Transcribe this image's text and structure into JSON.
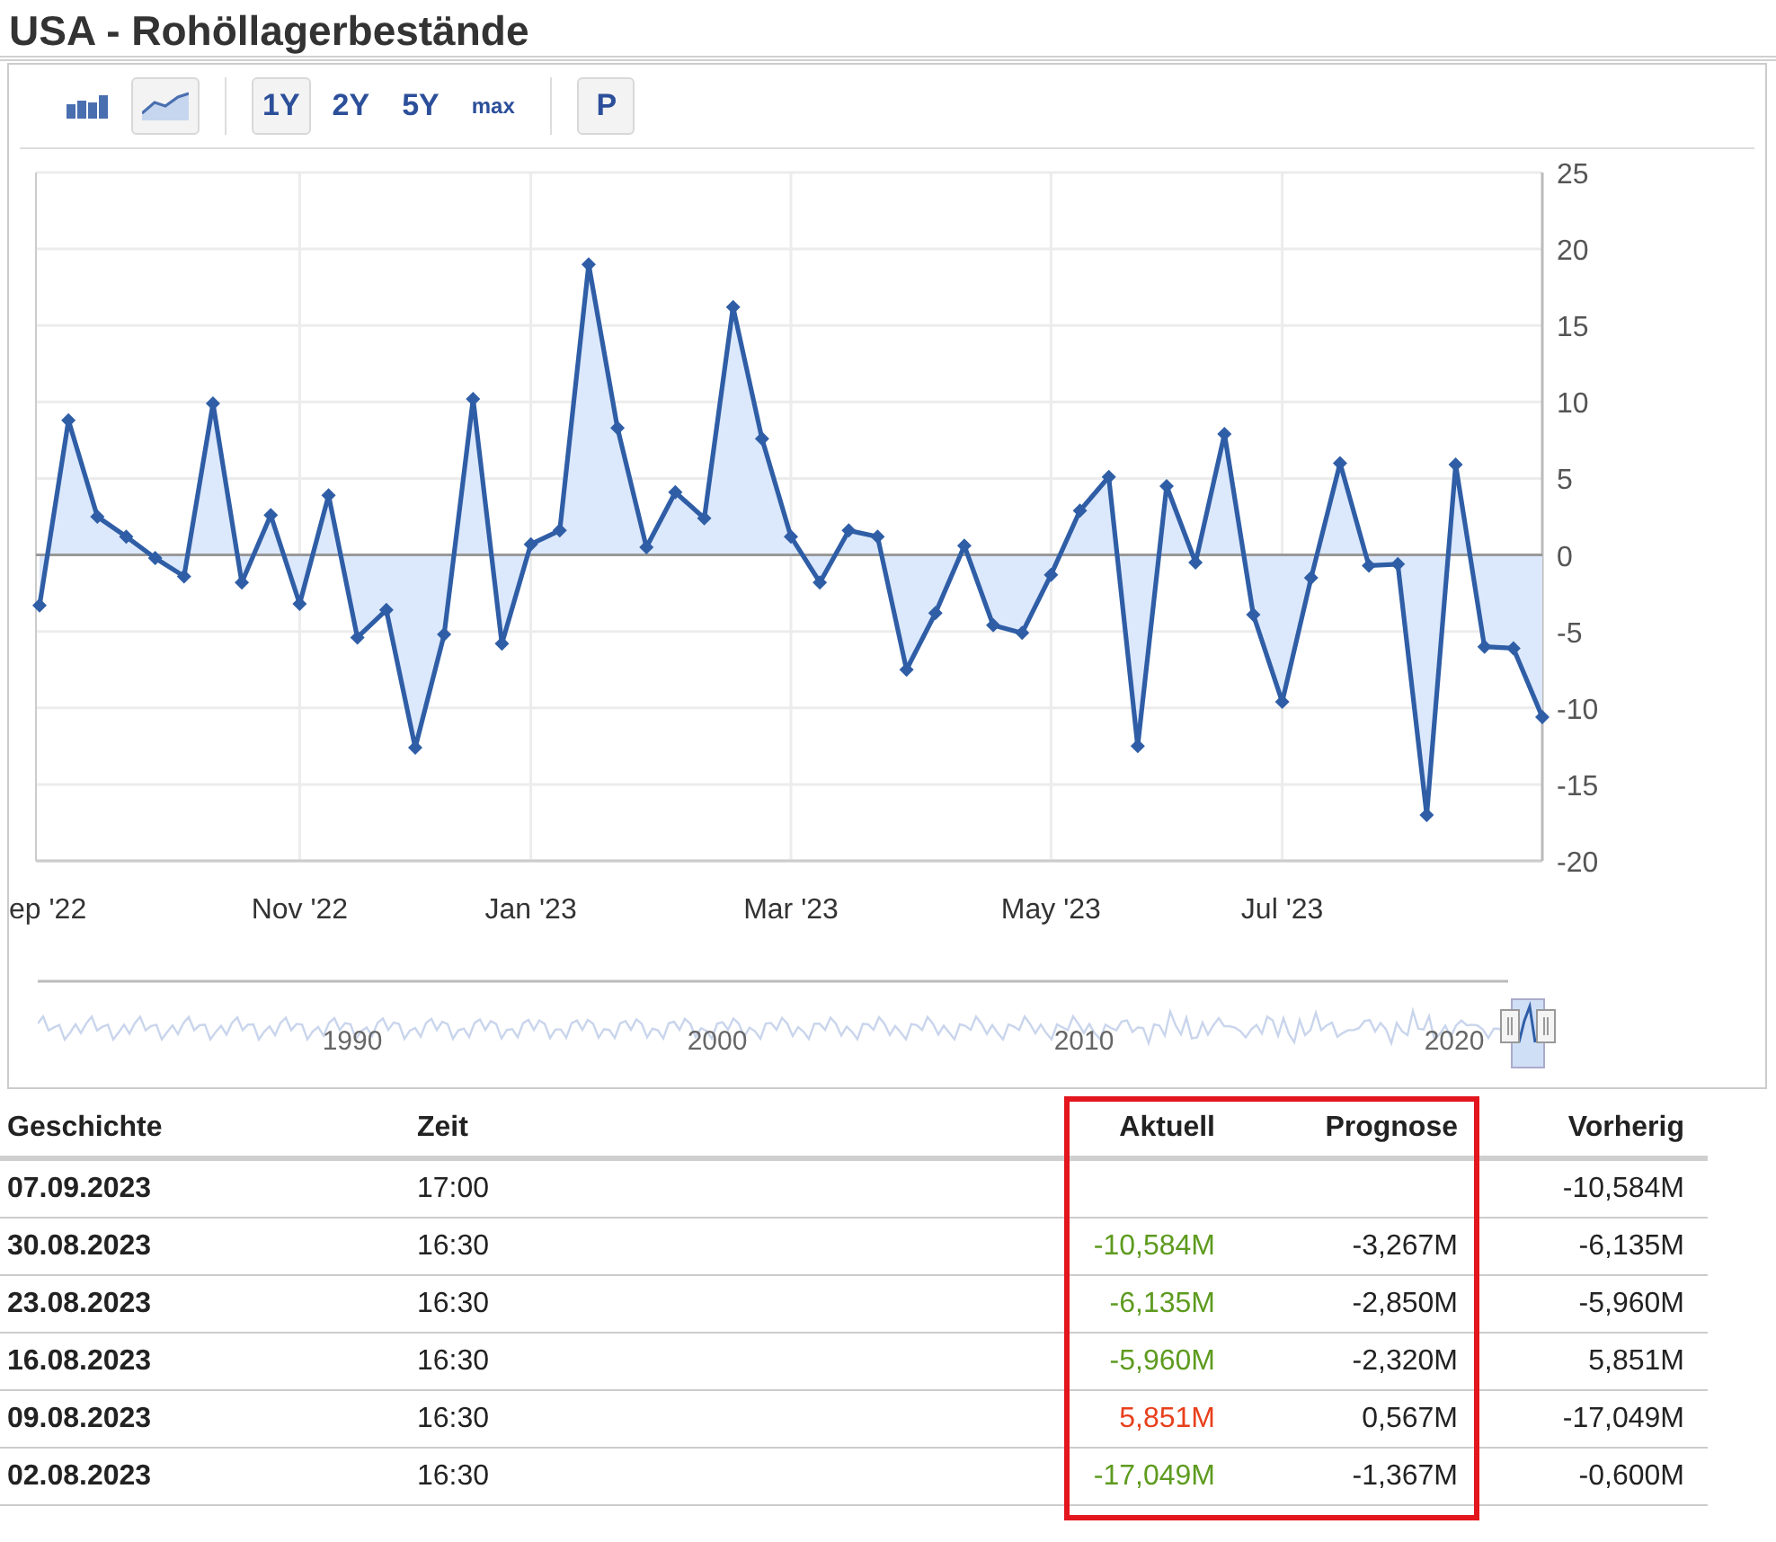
{
  "title": "USA - Rohöllagerbestände",
  "toolbar": {
    "chart_types": [
      {
        "kind": "bar",
        "selected": false
      },
      {
        "kind": "area",
        "selected": true
      }
    ],
    "ranges": [
      {
        "label": "1Y",
        "selected": true
      },
      {
        "label": "2Y",
        "selected": false
      },
      {
        "label": "5Y",
        "selected": false
      },
      {
        "label": "max",
        "selected": false
      }
    ],
    "tools": [
      {
        "label": "P",
        "selected": true
      }
    ]
  },
  "chart": {
    "chart_data": {
      "type": "area",
      "categories": [
        "ep '22",
        null,
        null,
        null,
        null,
        null,
        null,
        null,
        null,
        "Nov '22",
        null,
        null,
        null,
        null,
        null,
        null,
        null,
        "Jan '23",
        null,
        null,
        null,
        null,
        null,
        null,
        null,
        null,
        "Mar '23",
        null,
        null,
        null,
        null,
        null,
        null,
        null,
        null,
        "May '23",
        null,
        null,
        null,
        null,
        null,
        null,
        null,
        "Jul '23",
        null,
        null,
        null,
        null,
        null,
        null,
        null,
        null,
        null
      ],
      "series": [
        {
          "color": "#2f5ea6",
          "values": [
            -3.3,
            8.8,
            2.5,
            1.2,
            -0.2,
            -1.4,
            9.9,
            -1.8,
            2.6,
            -3.2,
            3.9,
            -5.4,
            -3.6,
            -12.6,
            -5.2,
            10.2,
            -5.8,
            0.7,
            1.6,
            19.0,
            8.3,
            0.5,
            4.1,
            2.4,
            16.2,
            7.6,
            1.2,
            -1.8,
            1.6,
            1.2,
            -7.5,
            -3.8,
            0.6,
            -4.6,
            -5.1,
            -1.3,
            2.9,
            5.1,
            -12.5,
            4.5,
            -0.5,
            7.9,
            -3.9,
            -9.6,
            -1.5,
            6.0,
            -0.7,
            -0.6,
            -17.0,
            5.9,
            -6.0,
            -6.1,
            -10.6
          ]
        }
      ],
      "ylim": [
        -20,
        25
      ],
      "grid": true,
      "yticks": [
        25,
        20,
        15,
        10,
        5,
        0,
        -5,
        -10,
        -15,
        -20
      ]
    }
  },
  "navigator": {
    "years": [
      "1990",
      "2000",
      "2010",
      "2020"
    ]
  },
  "table": {
    "columns": [
      {
        "label": "Geschichte",
        "highlighted": false
      },
      {
        "label": "Zeit",
        "highlighted": false
      },
      {
        "label": "Aktuell",
        "highlighted": true
      },
      {
        "label": "Prognose",
        "highlighted": true
      },
      {
        "label": "Vorherig",
        "highlighted": false
      }
    ],
    "rows": [
      {
        "date": "07.09.2023",
        "time": "17:00",
        "previous": "-10,584M"
      },
      {
        "date": "30.08.2023",
        "time": "16:30",
        "actual": {
          "text": "-10,584M",
          "color": "#5e9b1f"
        },
        "forecast": "-3,267M",
        "previous": "-6,135M"
      },
      {
        "date": "23.08.2023",
        "time": "16:30",
        "actual": {
          "text": "-6,135M",
          "color": "#5e9b1f"
        },
        "forecast": "-2,850M",
        "previous": "-5,960M"
      },
      {
        "date": "16.08.2023",
        "time": "16:30",
        "actual": {
          "text": "-5,960M",
          "color": "#5e9b1f"
        },
        "forecast": "-2,320M",
        "previous": "5,851M"
      },
      {
        "date": "09.08.2023",
        "time": "16:30",
        "actual": {
          "text": "5,851M",
          "color": "#e8401c"
        },
        "forecast": "0,567M",
        "previous": "-17,049M"
      },
      {
        "date": "02.08.2023",
        "time": "16:30",
        "actual": {
          "text": "-17,049M",
          "color": "#5e9b1f"
        },
        "forecast": "-1,367M",
        "previous": "-0,600M"
      }
    ]
  }
}
